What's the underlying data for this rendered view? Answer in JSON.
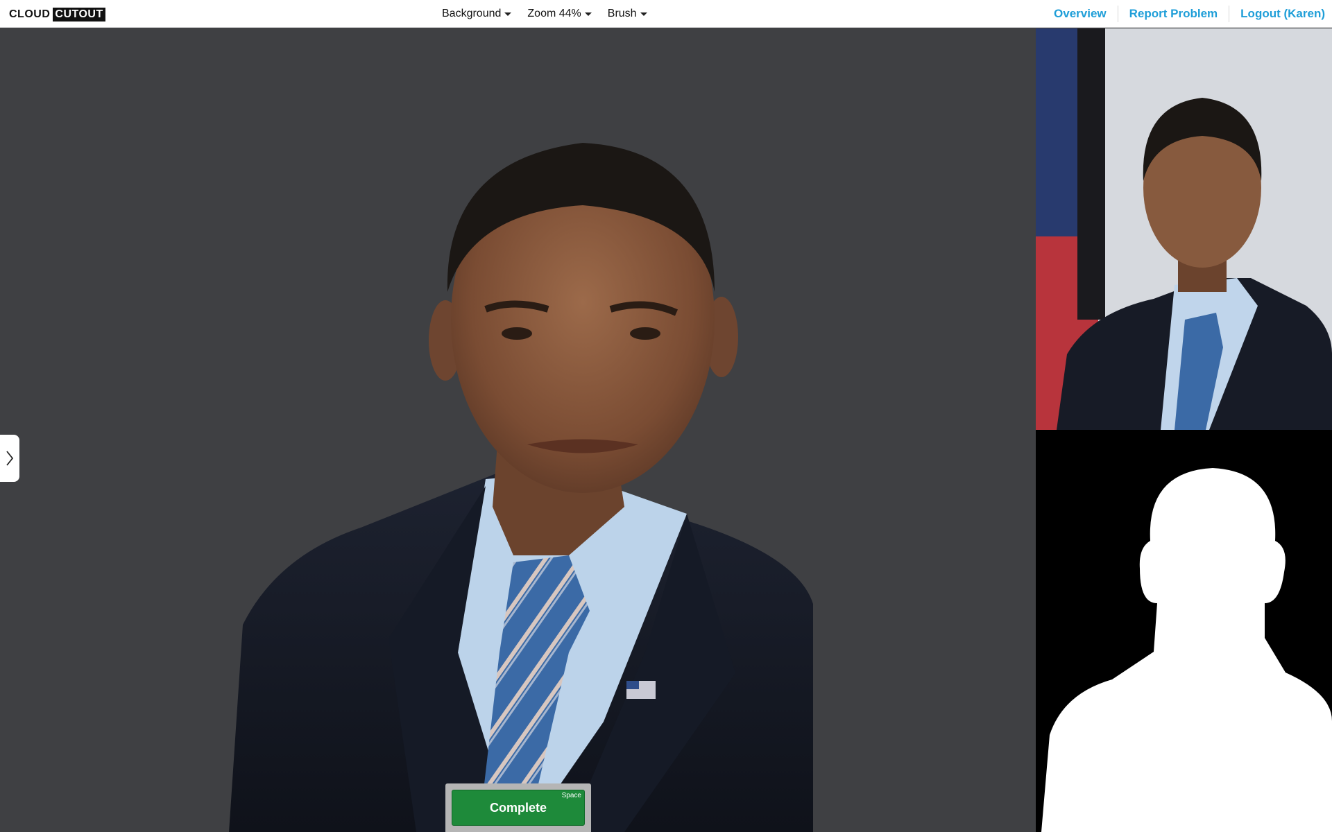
{
  "brand": {
    "word1": "CLOUD",
    "word2": "CUTOUT"
  },
  "menus": [
    {
      "label": "Background"
    },
    {
      "label": "Zoom 44%"
    },
    {
      "label": "Brush"
    }
  ],
  "nav": {
    "overview": "Overview",
    "report": "Report Problem",
    "logout": "Logout (Karen)"
  },
  "complete": {
    "label": "Complete",
    "shortcut": "Space"
  },
  "colors": {
    "accent": "#1e9ed8",
    "complete_green": "#1e8a3a",
    "canvas_bg": "#3f4043"
  },
  "icons": {
    "expander": "chevron-right-icon"
  }
}
